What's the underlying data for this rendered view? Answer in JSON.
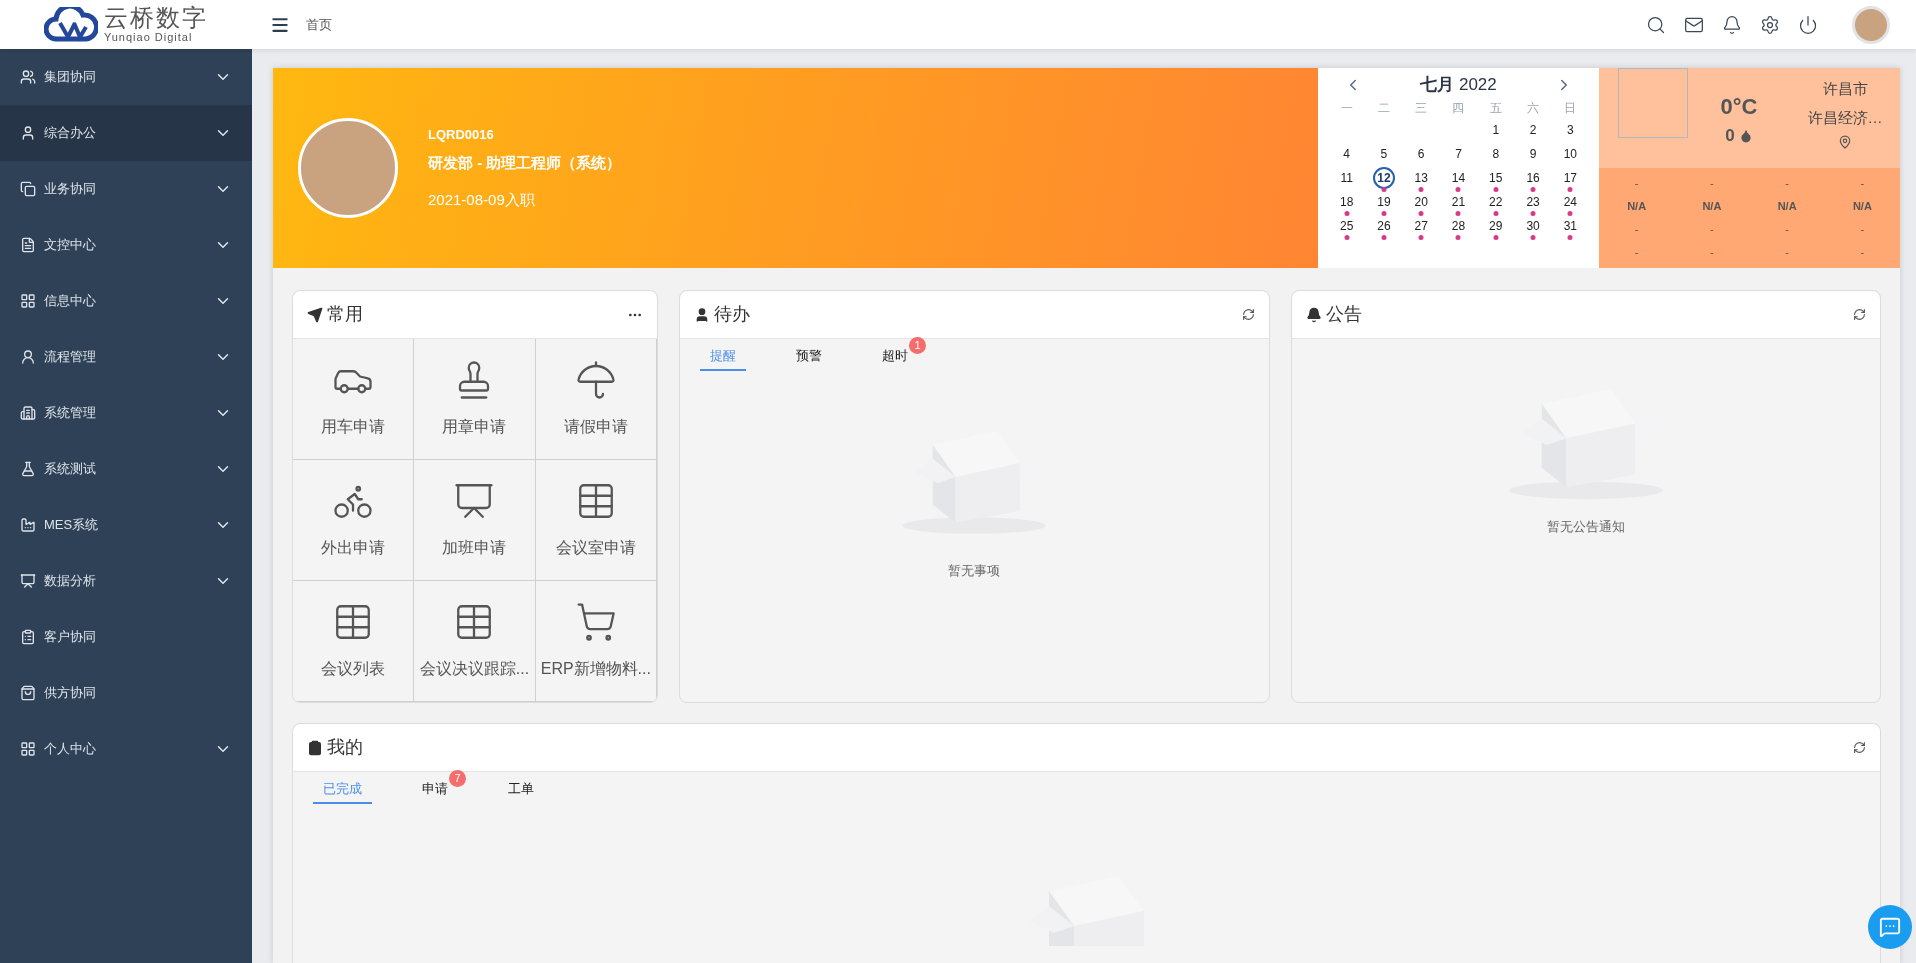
{
  "header": {
    "logo_title": "云桥数字",
    "logo_subtitle": "Yunqiao Digital",
    "breadcrumb": "首页"
  },
  "sidebar": {
    "items": [
      {
        "label": "集团协同",
        "selected": false,
        "expandable": true
      },
      {
        "label": "综合办公",
        "selected": true,
        "expandable": true
      },
      {
        "label": "业务协同",
        "selected": false,
        "expandable": true
      },
      {
        "label": "文控中心",
        "selected": false,
        "expandable": true
      },
      {
        "label": "信息中心",
        "selected": false,
        "expandable": true
      },
      {
        "label": "流程管理",
        "selected": false,
        "expandable": true
      },
      {
        "label": "系统管理",
        "selected": false,
        "expandable": true
      },
      {
        "label": "系统测试",
        "selected": false,
        "expandable": true
      },
      {
        "label": "MES系统",
        "selected": false,
        "expandable": true
      },
      {
        "label": "数据分析",
        "selected": false,
        "expandable": true
      },
      {
        "label": "客户协同",
        "selected": false,
        "expandable": false
      },
      {
        "label": "供方协同",
        "selected": false,
        "expandable": false
      },
      {
        "label": "个人中心",
        "selected": false,
        "expandable": true
      }
    ]
  },
  "profile": {
    "employee_id": "LQRD0016",
    "position": "研发部 - 助理工程师（系统）",
    "joined": "2021-08-09入职"
  },
  "calendar": {
    "month": "七月",
    "year": "2022",
    "weekdays": [
      "一",
      "二",
      "三",
      "四",
      "五",
      "六",
      "日"
    ],
    "weeks": [
      [
        {
          "kind": "empty"
        },
        {
          "kind": "empty"
        },
        {
          "kind": "empty"
        },
        {
          "kind": "empty"
        },
        {
          "kind": "day",
          "label": "1",
          "selected": false,
          "marked": false
        },
        {
          "kind": "day",
          "label": "2",
          "selected": false,
          "marked": false
        },
        {
          "kind": "day",
          "label": "3",
          "selected": false,
          "marked": false
        }
      ],
      [
        {
          "kind": "day",
          "label": "4",
          "selected": false,
          "marked": false
        },
        {
          "kind": "day",
          "label": "5",
          "selected": false,
          "marked": false
        },
        {
          "kind": "day",
          "label": "6",
          "selected": false,
          "marked": false
        },
        {
          "kind": "day",
          "label": "7",
          "selected": false,
          "marked": false
        },
        {
          "kind": "day",
          "label": "8",
          "selected": false,
          "marked": false
        },
        {
          "kind": "day",
          "label": "9",
          "selected": false,
          "marked": false
        },
        {
          "kind": "day",
          "label": "10",
          "selected": false,
          "marked": false
        }
      ],
      [
        {
          "kind": "day",
          "label": "11",
          "selected": false,
          "marked": false
        },
        {
          "kind": "day",
          "label": "12",
          "selected": true,
          "marked": true
        },
        {
          "kind": "day",
          "label": "13",
          "selected": false,
          "marked": true
        },
        {
          "kind": "day",
          "label": "14",
          "selected": false,
          "marked": true
        },
        {
          "kind": "day",
          "label": "15",
          "selected": false,
          "marked": true
        },
        {
          "kind": "day",
          "label": "16",
          "selected": false,
          "marked": true
        },
        {
          "kind": "day",
          "label": "17",
          "selected": false,
          "marked": true
        }
      ],
      [
        {
          "kind": "day",
          "label": "18",
          "selected": false,
          "marked": true
        },
        {
          "kind": "day",
          "label": "19",
          "selected": false,
          "marked": true
        },
        {
          "kind": "day",
          "label": "20",
          "selected": false,
          "marked": true
        },
        {
          "kind": "day",
          "label": "21",
          "selected": false,
          "marked": true
        },
        {
          "kind": "day",
          "label": "22",
          "selected": false,
          "marked": true
        },
        {
          "kind": "day",
          "label": "23",
          "selected": false,
          "marked": true
        },
        {
          "kind": "day",
          "label": "24",
          "selected": false,
          "marked": true
        }
      ],
      [
        {
          "kind": "day",
          "label": "25",
          "selected": false,
          "marked": true
        },
        {
          "kind": "day",
          "label": "26",
          "selected": false,
          "marked": true
        },
        {
          "kind": "day",
          "label": "27",
          "selected": false,
          "marked": true
        },
        {
          "kind": "day",
          "label": "28",
          "selected": false,
          "marked": true
        },
        {
          "kind": "day",
          "label": "29",
          "selected": false,
          "marked": true
        },
        {
          "kind": "day",
          "label": "30",
          "selected": false,
          "marked": true
        },
        {
          "kind": "day",
          "label": "31",
          "selected": false,
          "marked": true
        }
      ]
    ]
  },
  "weather": {
    "temperature": "0°C",
    "humidity": "0",
    "city": "许昌市",
    "district": "许昌经济…",
    "forecast": [
      [
        "-",
        "-",
        "-",
        "-"
      ],
      [
        "N/A",
        "N/A",
        "N/A",
        "N/A"
      ],
      [
        "-",
        "-",
        "-",
        "-"
      ],
      [
        "-",
        "-",
        "-",
        "-"
      ]
    ]
  },
  "favorites": {
    "title": "常用",
    "tiles": [
      {
        "label": "用车申请"
      },
      {
        "label": "用章申请"
      },
      {
        "label": "请假申请"
      },
      {
        "label": "外出申请"
      },
      {
        "label": "加班申请"
      },
      {
        "label": "会议室申请"
      },
      {
        "label": "会议列表"
      },
      {
        "label": "会议决议跟踪..."
      },
      {
        "label": "ERP新增物料..."
      }
    ]
  },
  "todo": {
    "title": "待办",
    "tabs": [
      {
        "label": "提醒",
        "selected": true
      },
      {
        "label": "预警",
        "selected": false
      },
      {
        "label": "超时",
        "selected": false,
        "badge": "1"
      }
    ],
    "empty_text": "暂无事项"
  },
  "notices": {
    "title": "公告",
    "empty_text": "暂无公告通知"
  },
  "mine": {
    "title": "我的",
    "tabs": [
      {
        "label": "已完成",
        "selected": true
      },
      {
        "label": "申请",
        "selected": false,
        "badge": "7"
      },
      {
        "label": "工单",
        "selected": false
      }
    ]
  }
}
